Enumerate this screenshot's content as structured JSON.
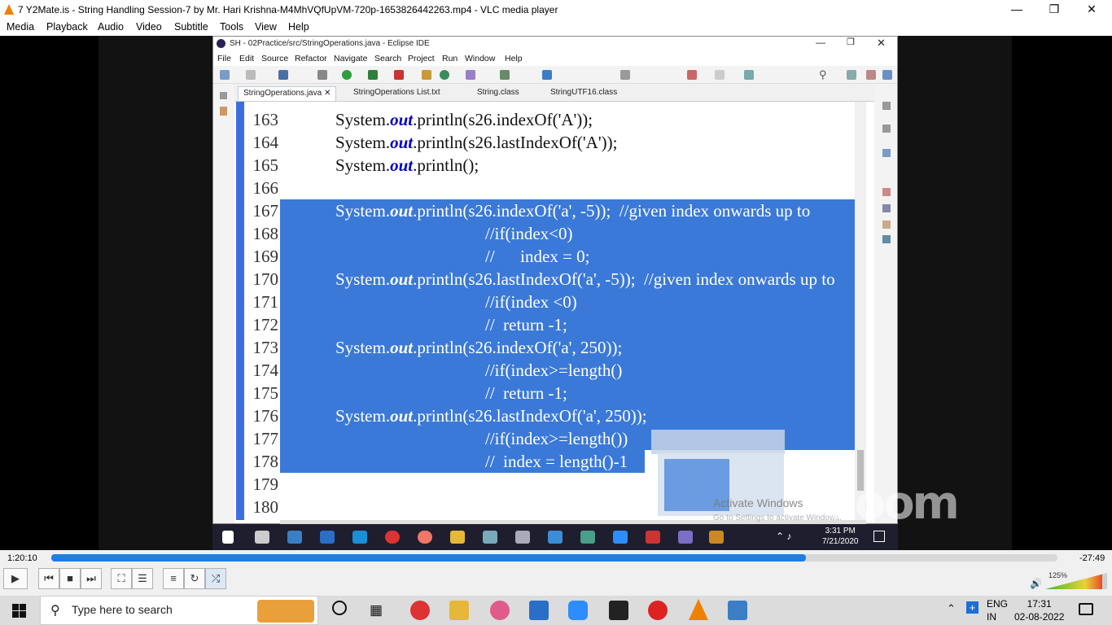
{
  "vlc": {
    "title": "7 Y2Mate.is - String Handling Session-7  by Mr. Hari Krishna-M4MhVQfUpVM-720p-1653826442263.mp4 - VLC media player",
    "menu": [
      "Media",
      "Playback",
      "Audio",
      "Video",
      "Subtitle",
      "Tools",
      "View",
      "Help"
    ],
    "time_elapsed": "1:20:10",
    "time_remaining": "-27:49",
    "progress": 0.75,
    "volume_label": "125%"
  },
  "eclipse": {
    "title": "SH - 02Practice/src/StringOperations.java - Eclipse IDE",
    "menu": [
      "File",
      "Edit",
      "Source",
      "Refactor",
      "Navigate",
      "Search",
      "Project",
      "Run",
      "Window",
      "Help"
    ],
    "tabs": [
      "StringOperations.java",
      "StringOperations List.txt",
      "String.class",
      "StringUTF16.class"
    ],
    "code_lines": [
      {
        "num": "163",
        "pre": "System.",
        "out": "out",
        "post": ".println(s26.indexOf('A'));",
        "selected": false,
        "indent": 68
      },
      {
        "num": "164",
        "pre": "System.",
        "out": "out",
        "post": ".println(s26.lastIndexOf('A'));",
        "selected": false,
        "indent": 68
      },
      {
        "num": "165",
        "pre": "System.",
        "out": "out",
        "post": ".println();",
        "selected": false,
        "indent": 68
      },
      {
        "num": "166",
        "pre": "",
        "out": "",
        "post": "",
        "selected": false,
        "indent": 68
      },
      {
        "num": "167",
        "pre": "System.",
        "out": "out",
        "post": ".println(s26.indexOf('a', -5));  //given index onwards up to",
        "selected": true,
        "indent": 68
      },
      {
        "num": "168",
        "pre": "",
        "out": "",
        "post": "//if(index<0)",
        "selected": true,
        "indent": 252
      },
      {
        "num": "169",
        "pre": "",
        "out": "",
        "post": "//      index = 0;",
        "selected": true,
        "indent": 252
      },
      {
        "num": "170",
        "pre": "System.",
        "out": "out",
        "post": ".println(s26.lastIndexOf('a', -5));  //given index onwards up to",
        "selected": true,
        "indent": 68
      },
      {
        "num": "171",
        "pre": "",
        "out": "",
        "post": "//if(index <0)",
        "selected": true,
        "indent": 252
      },
      {
        "num": "172",
        "pre": "",
        "out": "",
        "post": "//  return -1;",
        "selected": true,
        "indent": 252
      },
      {
        "num": "173",
        "pre": "System.",
        "out": "out",
        "post": ".println(s26.indexOf('a', 250));",
        "selected": true,
        "indent": 68
      },
      {
        "num": "174",
        "pre": "",
        "out": "",
        "post": "//if(index>=length()",
        "selected": true,
        "indent": 252
      },
      {
        "num": "175",
        "pre": "",
        "out": "",
        "post": "//  return -1;",
        "selected": true,
        "indent": 252
      },
      {
        "num": "176",
        "pre": "System.",
        "out": "out",
        "post": ".println(s26.lastIndexOf('a', 250));",
        "selected": true,
        "indent": 68
      },
      {
        "num": "177",
        "pre": "",
        "out": "",
        "post": "//if(index>=length())",
        "selected": true,
        "indent": 252
      },
      {
        "num": "178",
        "pre": "",
        "out": "",
        "post": "//  index = length()-1",
        "selected": true,
        "indent": 252
      },
      {
        "num": "179",
        "pre": "",
        "out": "",
        "post": "",
        "selected": false,
        "indent": 68
      },
      {
        "num": "180",
        "pre": "",
        "out": "",
        "post": "",
        "selected": false,
        "indent": 68
      }
    ],
    "watermark_activate": "Activate Windows",
    "watermark_settings": "Go to Settings to activate Windows.",
    "zoom_logo": "zoom",
    "inner_clock_time": "3:31 PM",
    "inner_clock_date": "7/21/2020"
  },
  "taskbar": {
    "search_placeholder": "Type here to search",
    "lang_1": "ENG",
    "lang_2": "IN",
    "time": "17:31",
    "date": "02-08-2022"
  },
  "colors": {
    "selection": "#3b79d8",
    "seek_fill": "#1f7fe0",
    "vlc_orange": "#f08000"
  }
}
